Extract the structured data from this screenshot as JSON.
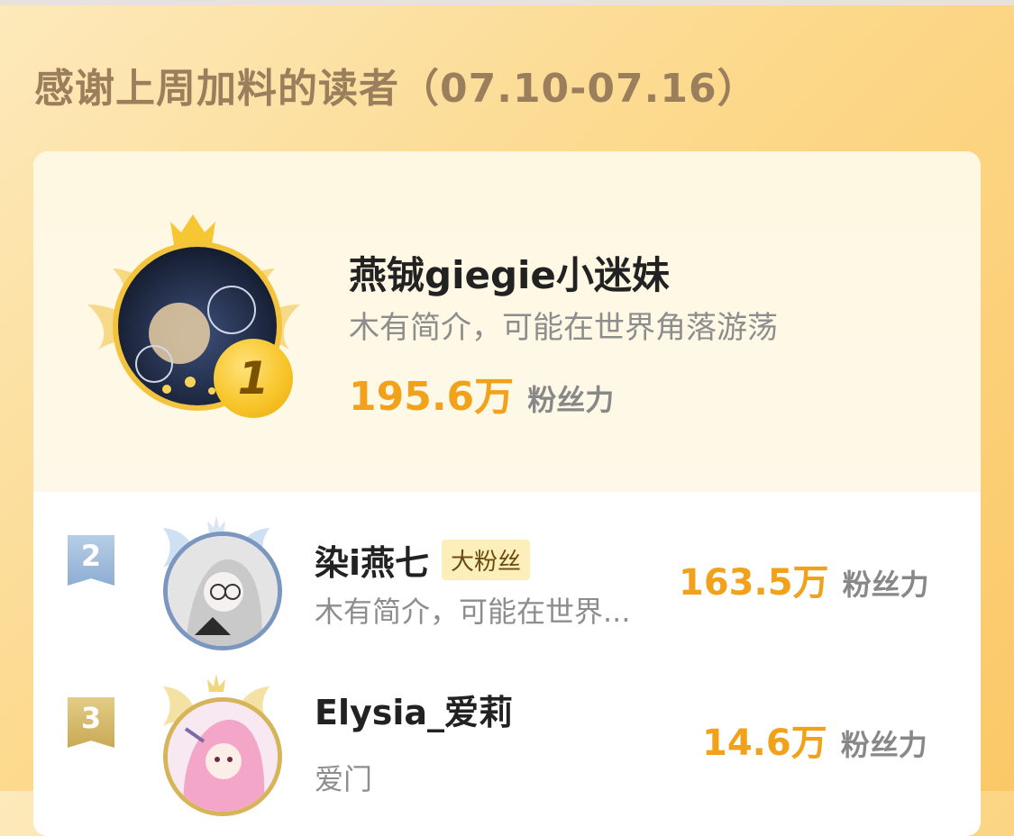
{
  "header": {
    "title": "感谢上周加料的读者（07.10-07.16）"
  },
  "top_reader": {
    "rank": "1",
    "name": "燕铖giegie小迷妹",
    "bio": "木有简介，可能在世界角落游荡",
    "fans_value": "195.6万",
    "fans_label": "粉丝力"
  },
  "readers": [
    {
      "rank": "2",
      "name": "染i燕七",
      "tag": "大粉丝",
      "bio": "木有简介，可能在世界...",
      "fans_value": "163.5万",
      "fans_label": "粉丝力"
    },
    {
      "rank": "3",
      "name": "Elysia_爱莉",
      "bio": "爱门",
      "fans_value": "14.6万",
      "fans_label": "粉丝力"
    }
  ],
  "colors": {
    "accent_orange": "#f2a21a",
    "rank2_blue": "#8daed3",
    "rank3_gold": "#c9aa55",
    "tag_bg": "#fdefb9"
  }
}
